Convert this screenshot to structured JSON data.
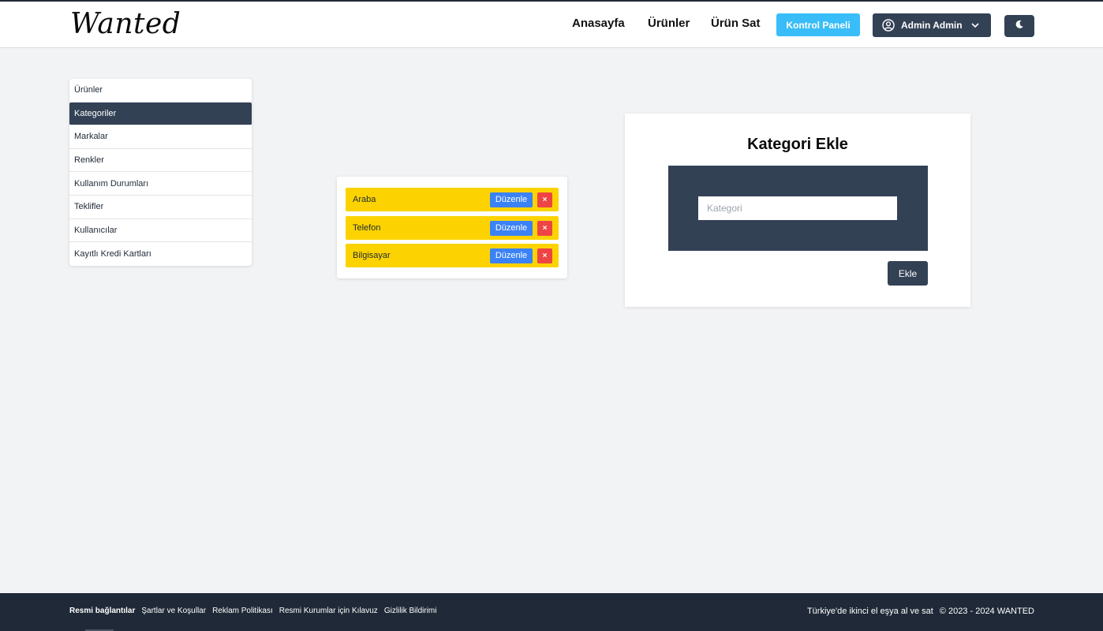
{
  "header": {
    "logo": "Wanted",
    "nav": [
      "Anasayfa",
      "Ürünler",
      "Ürün Sat"
    ],
    "panel_button": "Kontrol Paneli",
    "user_menu": "Admin Admin",
    "theme_toggle_icon": "moon-icon"
  },
  "sidebar": {
    "items": [
      {
        "label": "Ürünler"
      },
      {
        "label": "Kategoriler"
      },
      {
        "label": "Markalar"
      },
      {
        "label": "Renkler"
      },
      {
        "label": "Kullanım Durumları"
      },
      {
        "label": "Teklifler"
      },
      {
        "label": "Kullanıcılar"
      },
      {
        "label": "Kayıtlı Kredi Kartları"
      }
    ],
    "active": "Kategoriler"
  },
  "categories": {
    "items": [
      {
        "name": "Araba",
        "edit": "Düzenle",
        "delete": "×"
      },
      {
        "name": "Telefon",
        "edit": "Düzenle",
        "delete": "×"
      },
      {
        "name": "Bilgisayar",
        "edit": "Düzenle",
        "delete": "×"
      }
    ]
  },
  "form": {
    "title": "Kategori Ekle",
    "input_value": "",
    "input_placeholder": "Kategori",
    "submit": "Ekle"
  },
  "footer": {
    "links": [
      "Resmi bağlantılar",
      "Şartlar ve Koşullar",
      "Reklam Politikası",
      "Resmi Kurumlar için Kılavuz",
      "Gizlilik Bildirimi"
    ],
    "tagline": "Türkiye'de ikinci el eşya al ve sat",
    "copyright": "© 2023 - 2024 WANTED"
  },
  "colors": {
    "primary_dark": "#334155",
    "panel_button": "#38bdf8",
    "category_row": "#fcd300",
    "edit_button": "#3b82f6",
    "delete_button": "#ef4444",
    "footer": "#1f2937"
  }
}
